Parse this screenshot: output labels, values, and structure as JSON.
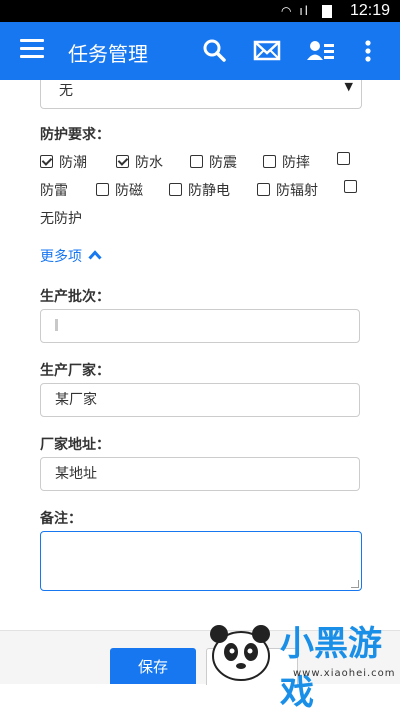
{
  "status_bar": {
    "time": "12:19",
    "icons": "wifi-icon signal-icon battery-icon"
  },
  "app_bar": {
    "title": "任务管理",
    "color": "#1777f0",
    "icons": [
      "menu-icon",
      "search-icon",
      "mail-icon",
      "contact-card-icon",
      "more-vert-icon"
    ]
  },
  "form": {
    "top_select": {
      "value": "无"
    },
    "protection": {
      "label": "防护要求：",
      "options": [
        {
          "label": "防潮",
          "checked": true
        },
        {
          "label": "防水",
          "checked": true
        },
        {
          "label": "防震",
          "checked": false
        },
        {
          "label": "防摔",
          "checked": false
        },
        {
          "label": "防雷",
          "checked": false
        },
        {
          "label": "防磁",
          "checked": false
        },
        {
          "label": "防静电",
          "checked": false
        },
        {
          "label": "防辐射",
          "checked": false
        },
        {
          "label": "无防护",
          "checked": false
        }
      ]
    },
    "more_link": "更多项",
    "batch": {
      "label": "生产批次：",
      "value": ""
    },
    "manufacturer": {
      "label": "生产厂家：",
      "value": "某厂家"
    },
    "address": {
      "label": "厂家地址：",
      "value": "某地址"
    },
    "remark": {
      "label": "备注：",
      "value": ""
    }
  },
  "footer": {
    "save_label": "保存"
  },
  "watermark": {
    "brand": "小黑游戏",
    "url": "www.xiaohei.com"
  }
}
